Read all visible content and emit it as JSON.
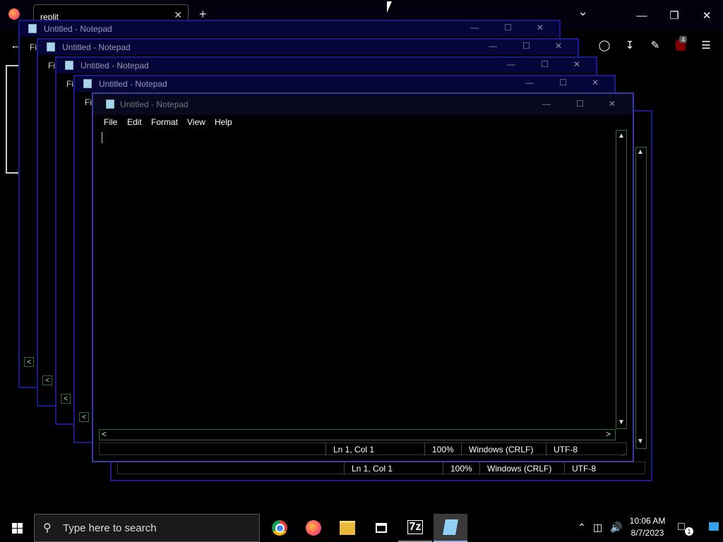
{
  "browser": {
    "tab_title": "replit",
    "tab_close": "✕",
    "new_tab": "+",
    "list_tabs": "⌄",
    "minimize": "—",
    "restore": "❐",
    "close": "✕",
    "extension_badge": "4"
  },
  "notepad": {
    "window_title": "Untitled - Notepad",
    "menu": [
      "File",
      "Edit",
      "Format",
      "View",
      "Help"
    ],
    "menu_truncated": "Fil",
    "minimize": "—",
    "maximize": "☐",
    "close": "✕",
    "status": {
      "position": "Ln 1, Col 1",
      "zoom": "100%",
      "line_endings": "Windows (CRLF)",
      "encoding": "UTF-8"
    }
  },
  "taskbar": {
    "search_placeholder": "Type here to search",
    "time": "10:06 AM",
    "date": "8/7/2023",
    "notification_count": "1",
    "apps": [
      "chrome-icon",
      "firefox-icon",
      "file-explorer-icon",
      "store-icon",
      "7zip-icon",
      "notepad-icon"
    ],
    "sevenzip_label": "7z"
  },
  "colors": {
    "window_border": "#1b1b8a",
    "scroll_green": "#2d6b2d",
    "taskbar_bg": "#000000"
  }
}
